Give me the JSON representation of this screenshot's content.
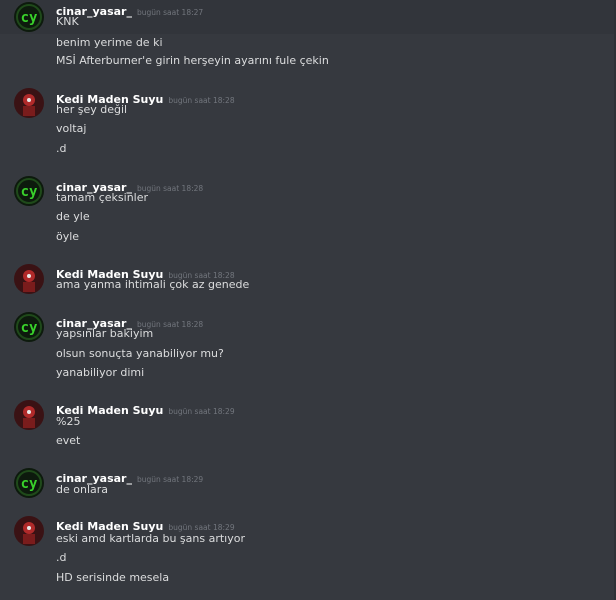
{
  "users": {
    "cinar": "cinar_yasar_",
    "kedi": "Kedi Maden Suyu"
  },
  "avatars": {
    "cinar": {
      "icon": "green-cy-logo-icon",
      "bg": "#0d1a0d",
      "accent": "#39d12b",
      "glyph": "cy"
    },
    "kedi": {
      "icon": "red-profile-avatar-icon",
      "bg": "#3a1214",
      "accent": "#b02a2a"
    }
  },
  "groups": [
    {
      "user": "cinar_yasar_",
      "time": "bugün saat 18:27",
      "lines": [
        "KNK",
        "benim yerime de ki",
        "MSİ Afterburner'e girin herşeyin ayarını fule çekin"
      ]
    },
    {
      "user": "Kedi Maden Suyu",
      "time": "bugün saat 18:28",
      "lines": [
        "her şey değil",
        "voltaj",
        ".d"
      ]
    },
    {
      "user": "cinar_yasar_",
      "time": "bugün saat 18:28",
      "lines": [
        "tamam çeksinler",
        "de yle",
        "öyle"
      ]
    },
    {
      "user": "Kedi Maden Suyu",
      "time": "bugün saat 18:28",
      "lines": [
        "ama yanma ihtimali çok az genede"
      ]
    },
    {
      "user": "cinar_yasar_",
      "time": "bugün saat 18:28",
      "lines": [
        "yapsınlar bakiyim",
        "olsun sonuçta yanabiliyor mu?",
        "yanabiliyor dimi"
      ]
    },
    {
      "user": "Kedi Maden Suyu",
      "time": "bugün saat 18:29",
      "lines": [
        "%25",
        "evet"
      ]
    },
    {
      "user": "cinar_yasar_",
      "time": "bugün saat 18:29",
      "lines": [
        "de onlara"
      ]
    },
    {
      "user": "Kedi Maden Suyu",
      "time": "bugün saat 18:29",
      "lines": [
        "eski amd kartlarda bu şans artıyor",
        ".d",
        "HD serisinde mesela"
      ]
    }
  ]
}
